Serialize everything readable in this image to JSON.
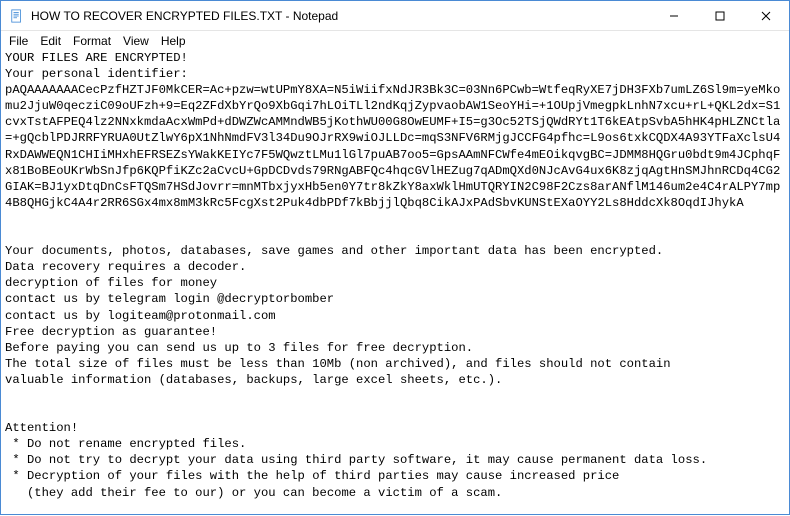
{
  "titlebar": {
    "filename": "HOW TO RECOVER ENCRYPTED FILES.TXT",
    "appname": "Notepad"
  },
  "menu": {
    "file": "File",
    "edit": "Edit",
    "format": "Format",
    "view": "View",
    "help": "Help"
  },
  "body": {
    "header": "YOUR FILES ARE ENCRYPTED!",
    "pid_label": "Your personal identifier:",
    "identifier": "pAQAAAAAAACecPzfHZTJF0MkCER=Ac+pzw=wtUPmY8XA=N5iWiifxNdJR3Bk3C=03Nn6PCwb=WtfeqRyXE7jDH3FXb7umLZ6Sl9m=yeMkomu2JjuW0qecziC09oUFzh+9=Eq2ZFdXbYrQo9XbGqi7hLOiTLl2ndKqjZypvaobAW1SeoYHi=+1OUpjVmegpkLnhN7xcu+rL+QKL2dx=S1cvxTstAFPEQ4lz2NNxkmdaAcxWmPd+dDWZWcAMMndWB5jKothWU00G8OwEUMF+I5=g3Oc52TSjQWdRYt1T6kEAtpSvbA5hHK4pHLZNCtla=+gQcblPDJRRFYRUA0UtZlwY6pX1NhNmdFV3l34Du9OJrRX9wiOJLLDc=mqS3NFV6RMjgJCCFG4pfhc=L9os6txkCQDX4A93YTFaXclsU4RxDAWWEQN1CHIiMHxhEFRSEZsYWakKEIYc7F5WQwztLMu1lGl7puAB7oo5=GpsAAmNFCWfe4mEOikqvgBC=JDMM8HQGru0bdt9m4JCphqFx81BoBEoUKrWbSnJfp6KQPfiKZc2aCvcU+GpDCDvds79RNgABFQc4hqcGVlHEZug7qADmQXd0NJcAvG4ux6K8zjqAgtHnSMJhnRCDq4CG2GIAK=BJ1yxDtqDnCsFTQSm7HSdJovrr=mnMTbxjyxHb5en0Y7tr8kZkY8axWklHmUTQRYIN2C98F2Czs8arANflM146um2e4C4rALPY7mp4B8QHGjkC4A4r2RR6SGx4mx8mM3kRc5FcgXst2Puk4dbPDf7kBbjjlQbq8CikAJxPAdSbvKUNStEXaOYY2Ls8HddcXk8OqdIJhykA",
    "p1": "Your documents, photos, databases, save games and other important data has been encrypted.",
    "p2": "Data recovery requires a decoder.",
    "p3": "decryption of files for money",
    "p4": "contact us by telegram login @decryptorbomber",
    "p5": "contact us by logiteam@protonmail.com",
    "p6": "Free decryption as guarantee!",
    "p7": "Before paying you can send us up to 3 files for free decryption.",
    "p8": "The total size of files must be less than 10Mb (non archived), and files should not contain",
    "p9": "valuable information (databases, backups, large excel sheets, etc.).",
    "attention": "Attention!",
    "b1": " * Do not rename encrypted files.",
    "b2": " * Do not try to decrypt your data using third party software, it may cause permanent data loss.",
    "b3": " * Decryption of your files with the help of third parties may cause increased price",
    "b4": "   (they add their fee to our) or you can become a victim of a scam."
  }
}
